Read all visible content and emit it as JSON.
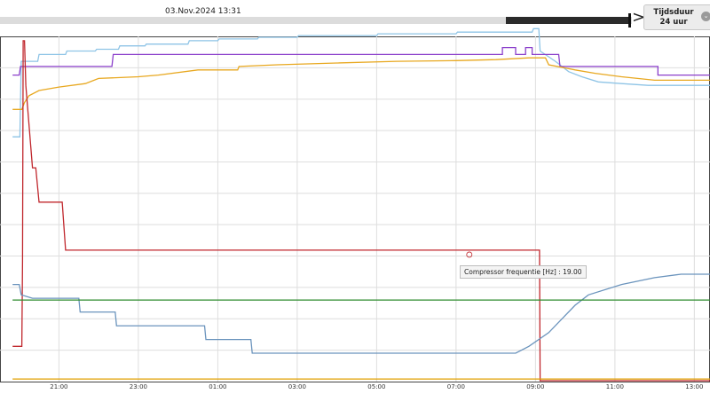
{
  "header": {
    "date_label": "03.Nov.2024 13:31",
    "duration_label": "Tijdsduur 24 uur",
    "arrow_glyph": ">",
    "chevron_glyph": "⌄"
  },
  "tooltip": {
    "label": "Compressor frequentie [Hz] : 19.00"
  },
  "chart_data": {
    "type": "line",
    "title": "",
    "xlabel": "",
    "ylabel": "",
    "x_ticks": [
      "21:00",
      "23:00",
      "01:00",
      "03:00",
      "05:00",
      "07:00",
      "09:00",
      "11:00",
      "13:00"
    ],
    "x_range": [
      "19:50",
      "13:31"
    ],
    "grid": true,
    "legend": "none",
    "series": [
      {
        "color": "#8ec4e6",
        "points": [
          [
            "19:50",
            0.71
          ],
          [
            "20:01",
            0.71
          ],
          [
            "20:03",
            0.93
          ],
          [
            "20:28",
            0.93
          ],
          [
            "20:30",
            0.95
          ],
          [
            "21:10",
            0.95
          ],
          [
            "21:12",
            0.96
          ],
          [
            "21:55",
            0.96
          ],
          [
            "21:57",
            0.965
          ],
          [
            "22:30",
            0.965
          ],
          [
            "22:32",
            0.975
          ],
          [
            "23:10",
            0.975
          ],
          [
            "23:12",
            0.98
          ],
          [
            "00:15",
            0.98
          ],
          [
            "00:17",
            0.99
          ],
          [
            "01:00",
            0.99
          ],
          [
            "01:02",
            0.995
          ],
          [
            "02:00",
            0.995
          ],
          [
            "02:02",
            1.0
          ],
          [
            "03:00",
            1.0
          ],
          [
            "03:02",
            1.005
          ],
          [
            "05:00",
            1.005
          ],
          [
            "05:02",
            1.01
          ],
          [
            "07:00",
            1.01
          ],
          [
            "07:02",
            1.015
          ],
          [
            "08:55",
            1.015
          ],
          [
            "08:57",
            1.025
          ],
          [
            "09:05",
            1.025
          ],
          [
            "09:07",
            0.96
          ],
          [
            "09:30",
            0.93
          ],
          [
            "09:50",
            0.9
          ],
          [
            "10:10",
            0.885
          ],
          [
            "10:35",
            0.87
          ],
          [
            "11:10",
            0.865
          ],
          [
            "11:50",
            0.86
          ],
          [
            "12:30",
            0.86
          ],
          [
            "13:31",
            0.86
          ]
        ]
      },
      {
        "color": "#8b3fcb",
        "points": [
          [
            "19:50",
            0.89
          ],
          [
            "20:00",
            0.89
          ],
          [
            "20:02",
            0.915
          ],
          [
            "22:20",
            0.915
          ],
          [
            "22:22",
            0.95
          ],
          [
            "08:10",
            0.95
          ],
          [
            "08:10",
            0.97
          ],
          [
            "08:30",
            0.97
          ],
          [
            "08:30",
            0.95
          ],
          [
            "08:45",
            0.95
          ],
          [
            "08:45",
            0.97
          ],
          [
            "08:55",
            0.97
          ],
          [
            "08:55",
            0.95
          ],
          [
            "09:35",
            0.95
          ],
          [
            "09:37",
            0.915
          ],
          [
            "12:05",
            0.915
          ],
          [
            "12:05",
            0.89
          ],
          [
            "12:15",
            0.89
          ],
          [
            "12:15",
            0.89
          ],
          [
            "13:31",
            0.89
          ]
        ]
      },
      {
        "color": "#e8a820",
        "points": [
          [
            "19:50",
            0.79
          ],
          [
            "20:04",
            0.79
          ],
          [
            "20:08",
            0.81
          ],
          [
            "20:15",
            0.83
          ],
          [
            "20:30",
            0.845
          ],
          [
            "21:00",
            0.855
          ],
          [
            "21:40",
            0.865
          ],
          [
            "22:00",
            0.88
          ],
          [
            "23:00",
            0.885
          ],
          [
            "23:30",
            0.89
          ],
          [
            "00:30",
            0.905
          ],
          [
            "01:30",
            0.905
          ],
          [
            "01:32",
            0.915
          ],
          [
            "02:30",
            0.92
          ],
          [
            "04:00",
            0.925
          ],
          [
            "05:30",
            0.93
          ],
          [
            "07:00",
            0.932
          ],
          [
            "08:00",
            0.935
          ],
          [
            "08:50",
            0.94
          ],
          [
            "09:15",
            0.94
          ],
          [
            "09:20",
            0.92
          ],
          [
            "10:00",
            0.905
          ],
          [
            "10:30",
            0.895
          ],
          [
            "11:10",
            0.885
          ],
          [
            "12:00",
            0.875
          ],
          [
            "13:31",
            0.875
          ]
        ]
      },
      {
        "color": "#c0272d",
        "points": [
          [
            "19:50",
            0.1
          ],
          [
            "20:04",
            0.1
          ],
          [
            "20:05",
            0.35
          ],
          [
            "20:06",
            0.99
          ],
          [
            "20:08",
            0.99
          ],
          [
            "20:10",
            0.86
          ],
          [
            "20:20",
            0.62
          ],
          [
            "20:25",
            0.62
          ],
          [
            "20:30",
            0.52
          ],
          [
            "21:05",
            0.52
          ],
          [
            "21:10",
            0.38
          ],
          [
            "09:06",
            0.38
          ],
          [
            "09:07",
            0.0
          ],
          [
            "13:31",
            0.0
          ]
        ]
      },
      {
        "color": "#6b94bd",
        "points": [
          [
            "19:50",
            0.28
          ],
          [
            "20:00",
            0.28
          ],
          [
            "20:03",
            0.25
          ],
          [
            "20:20",
            0.24
          ],
          [
            "21:30",
            0.24
          ],
          [
            "21:32",
            0.2
          ],
          [
            "22:25",
            0.2
          ],
          [
            "22:27",
            0.16
          ],
          [
            "00:40",
            0.16
          ],
          [
            "00:42",
            0.12
          ],
          [
            "01:50",
            0.12
          ],
          [
            "01:52",
            0.08
          ],
          [
            "08:30",
            0.08
          ],
          [
            "08:50",
            0.1
          ],
          [
            "09:20",
            0.14
          ],
          [
            "09:40",
            0.18
          ],
          [
            "10:00",
            0.22
          ],
          [
            "10:20",
            0.25
          ],
          [
            "11:10",
            0.28
          ],
          [
            "12:00",
            0.3
          ],
          [
            "12:40",
            0.31
          ],
          [
            "13:31",
            0.31
          ]
        ]
      },
      {
        "color": "#2e8b2e",
        "points": [
          [
            "19:50",
            0.235
          ],
          [
            "13:31",
            0.235
          ]
        ]
      },
      {
        "color": "#e0a000",
        "points": [
          [
            "19:50",
            0.005
          ],
          [
            "13:31",
            0.005
          ]
        ]
      }
    ]
  }
}
